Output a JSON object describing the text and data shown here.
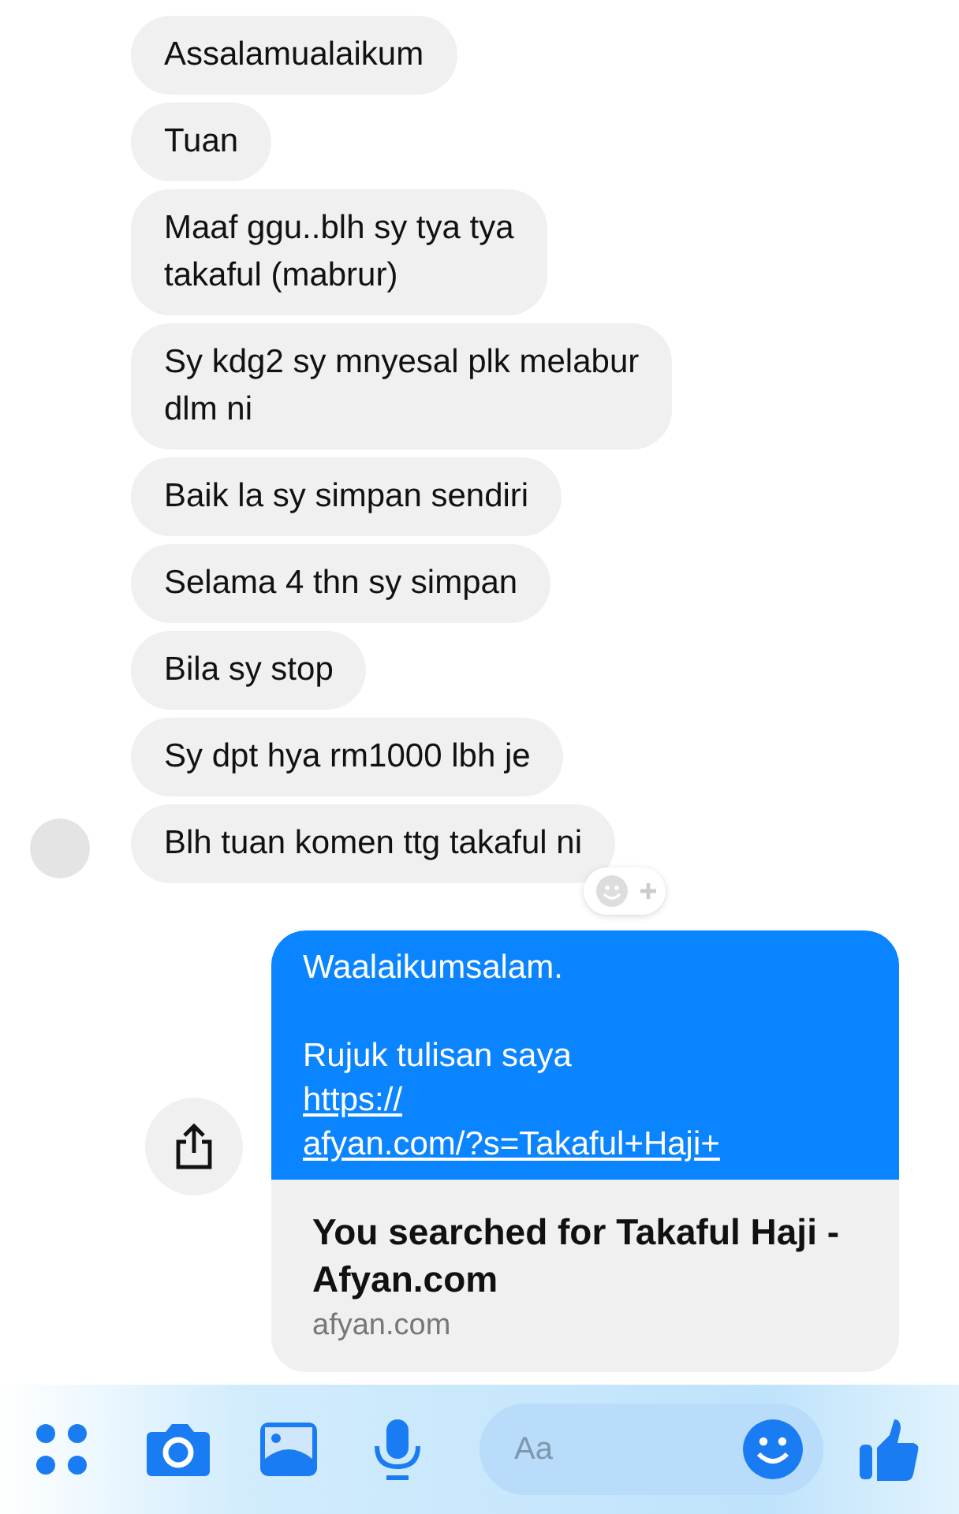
{
  "received": [
    {
      "text": "Assalamualaikum"
    },
    {
      "text": "Tuan"
    },
    {
      "text": "Maaf ggu..blh sy tya tya\ntakaful (mabrur)"
    },
    {
      "text": "Sy kdg2 sy mnyesal plk melabur\ndlm ni"
    },
    {
      "text": "Baik la sy simpan sendiri"
    },
    {
      "text": "Selama 4 thn sy simpan"
    },
    {
      "text": "Bila sy stop"
    },
    {
      "text": "Sy dpt hya rm1000 lbh je"
    },
    {
      "text": "Blh tuan komen ttg takaful ni",
      "avatar": true,
      "reaction_button": true
    }
  ],
  "sent": {
    "text": "Waalaikumsalam.\n\nRujuk tulisan saya ",
    "link": "https://\nafyan.com/?s=Takaful+Haji+",
    "preview": {
      "title": "You searched for Takaful Haji - Afyan.com",
      "domain": "afyan.com"
    }
  },
  "composer": {
    "placeholder": "Aa"
  }
}
